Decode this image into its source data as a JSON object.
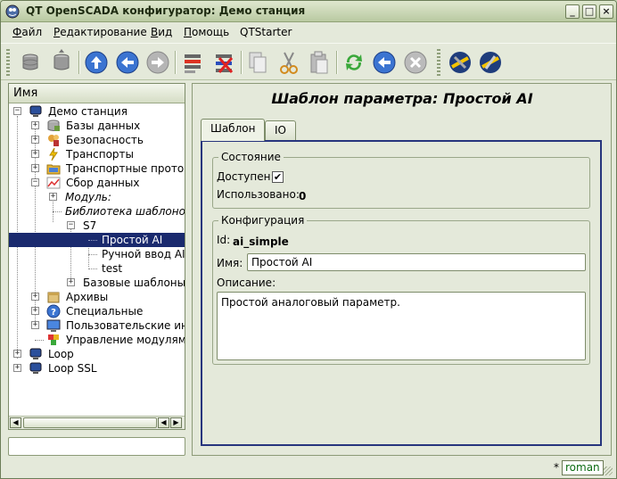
{
  "window": {
    "title": "QT OpenSCADA конфигуратор: Демо станция",
    "buttons": [
      "_",
      "□",
      "×"
    ]
  },
  "menu": [
    {
      "label": "Файл",
      "underline": "Ф",
      "rest": "айл"
    },
    {
      "label": "Редактирование",
      "underline": "Р",
      "rest": "едактирование"
    },
    {
      "label": "Вид",
      "underline": "В",
      "rest": "ид"
    },
    {
      "label": "Помощь",
      "underline": "П",
      "rest": "омощь"
    },
    {
      "label": "QTStarter",
      "underline": "",
      "rest": "QTStarter"
    }
  ],
  "toolbar": {
    "icons": [
      "db-load-icon",
      "db-save-icon",
      "up-icon",
      "back-icon",
      "forward-icon",
      "add-item-icon",
      "delete-item-icon",
      "copy-icon",
      "cut-icon",
      "paste-icon",
      "refresh-icon",
      "start-icon",
      "stop-icon",
      "qtcfg-icon",
      "uiprop-icon"
    ]
  },
  "tree": {
    "header": "Имя",
    "items": [
      {
        "label": "Демо станция",
        "italic": false,
        "icon": "computer-icon"
      },
      {
        "label": "Базы данных",
        "italic": false,
        "icon": "database-icon"
      },
      {
        "label": "Безопасность",
        "italic": false,
        "icon": "security-icon"
      },
      {
        "label": "Транспорты",
        "italic": false,
        "icon": "lightning-icon"
      },
      {
        "label": "Транспортные протоко",
        "italic": false,
        "icon": "folder-icon"
      },
      {
        "label": "Сбор данных",
        "italic": false,
        "icon": "chart-icon"
      },
      {
        "label": "Модуль:",
        "italic": true,
        "icon": ""
      },
      {
        "label": "Библиотека шаблонов",
        "italic": true,
        "icon": ""
      },
      {
        "label": "S7",
        "italic": false,
        "icon": ""
      },
      {
        "label": "Простой AI",
        "italic": false,
        "icon": ""
      },
      {
        "label": "Ручной ввод AI",
        "italic": false,
        "icon": ""
      },
      {
        "label": "test",
        "italic": false,
        "icon": ""
      },
      {
        "label": "Базовые шаблоны",
        "italic": false,
        "icon": ""
      },
      {
        "label": "Архивы",
        "italic": false,
        "icon": "archive-icon"
      },
      {
        "label": "Специальные",
        "italic": false,
        "icon": "help-icon"
      },
      {
        "label": "Пользовательские инт",
        "italic": false,
        "icon": "monitor-icon"
      },
      {
        "label": "Управление модулями",
        "italic": false,
        "icon": "modules-icon"
      },
      {
        "label": "Loop",
        "italic": false,
        "icon": "computer-icon"
      },
      {
        "label": "Loop SSL",
        "italic": false,
        "icon": "computer-icon"
      }
    ]
  },
  "page": {
    "title": "Шаблон параметра: Простой AI",
    "tabs": [
      "Шаблон",
      "IO"
    ],
    "state_group": "Состояние",
    "enabled_label": "Доступен:",
    "enabled_mark": "✔",
    "used_label": "Использовано:",
    "used_value": "0",
    "config_group": "Конфигурация",
    "id_label": "Id:",
    "id_value": "ai_simple",
    "name_label": "Имя:",
    "name_value": "Простой AI",
    "descr_label": "Описание:",
    "descr_value": "Простой аналоговый параметр."
  },
  "status": {
    "modified": "*",
    "user": "roman"
  },
  "colors": {
    "selection": "#1a2a6e",
    "tab_frame": "#27357d",
    "user_text": "#0c6b12"
  }
}
